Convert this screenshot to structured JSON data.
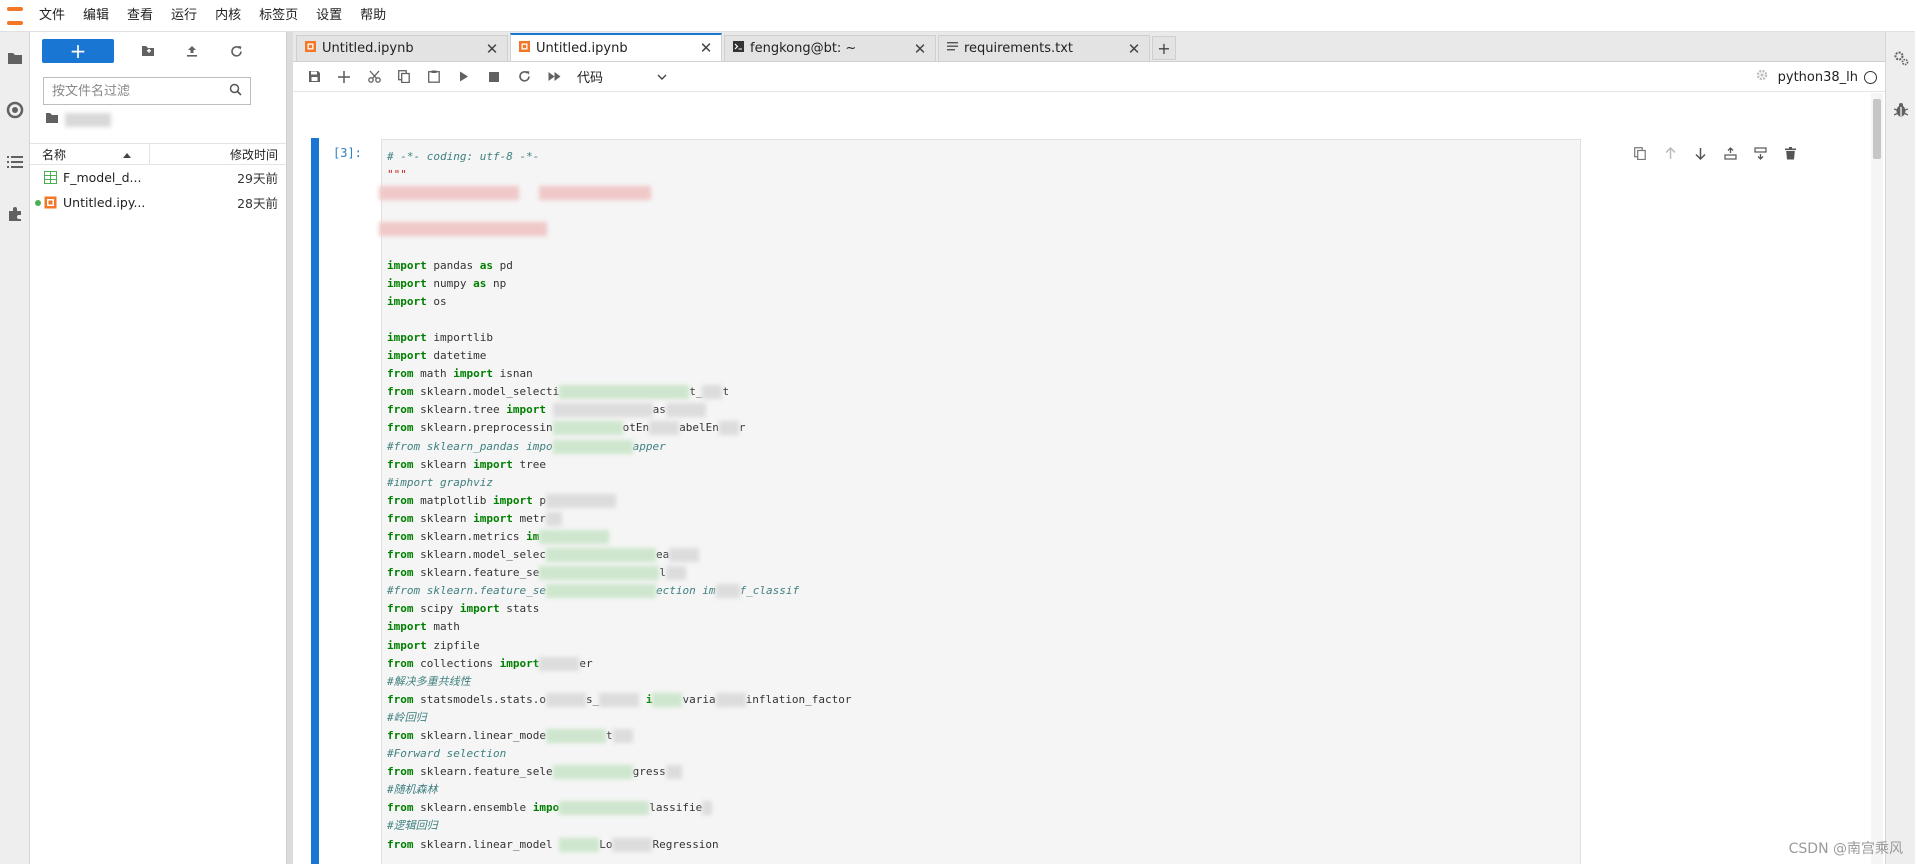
{
  "menu": {
    "items": [
      "文件",
      "编辑",
      "查看",
      "运行",
      "内核",
      "标签页",
      "设置",
      "帮助"
    ]
  },
  "activity": {
    "items": [
      "folder-icon",
      "running-icon",
      "toc-icon",
      "extension-icon"
    ]
  },
  "filebrowser": {
    "new_label": "+",
    "search_placeholder": "按文件名过滤",
    "header": {
      "name": "名称",
      "modified": "修改时间"
    },
    "files": [
      {
        "name": "F_model_d...",
        "modified": "29天前",
        "icon": "csv-icon",
        "running": false
      },
      {
        "name": "Untitled.ipy...",
        "modified": "28天前",
        "icon": "notebook-icon",
        "running": true
      }
    ]
  },
  "tabs": [
    {
      "label": "Untitled.ipynb",
      "icon": "notebook-icon",
      "active": false
    },
    {
      "label": "Untitled.ipynb",
      "icon": "notebook-icon",
      "active": true
    },
    {
      "label": "fengkong@bt: ~",
      "icon": "terminal-icon",
      "active": false
    },
    {
      "label": "requirements.txt",
      "icon": "text-file-icon",
      "active": false
    }
  ],
  "toolbar": {
    "cell_type": "代码",
    "kernel_name": "python38_lh"
  },
  "cell": {
    "prompt": "[3]:"
  },
  "watermark": "CSDN @南宫乘风",
  "colors": {
    "accent": "#1976d2",
    "logo": "#f37726",
    "keyword": "#008000",
    "comment": "#408080",
    "string": "#ba2121"
  }
}
